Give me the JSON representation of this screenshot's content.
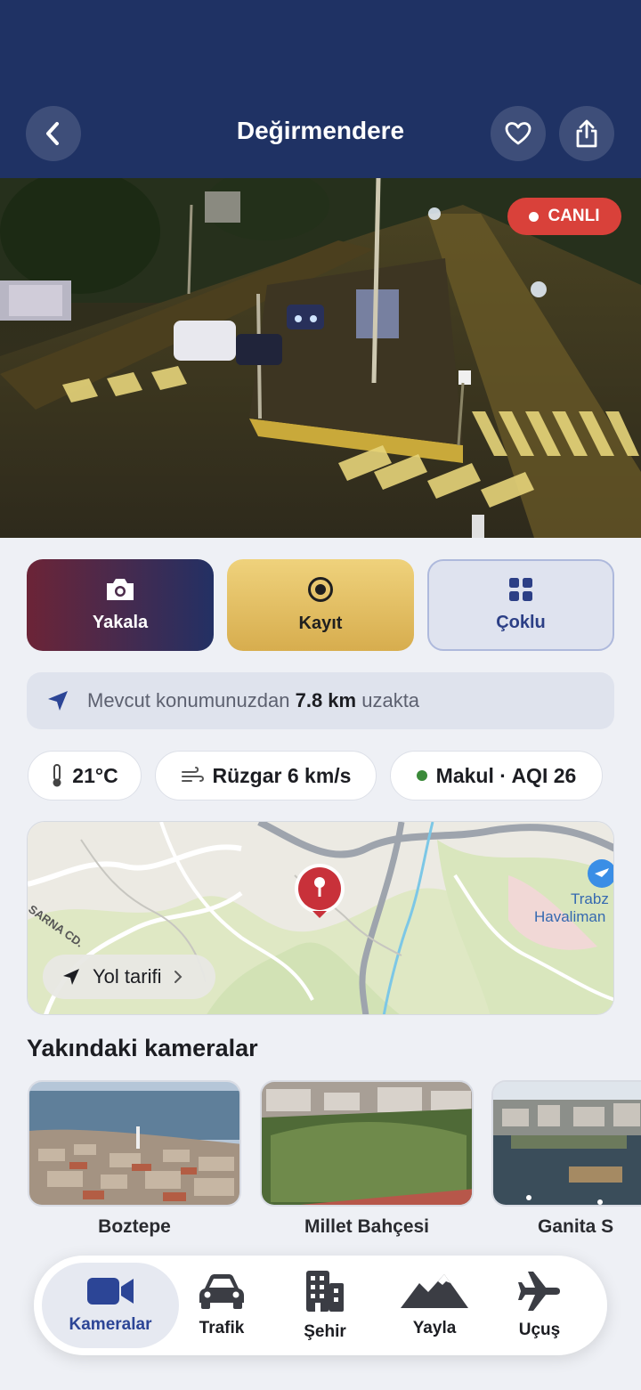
{
  "header": {
    "title": "Değirmendere",
    "back_icon": "chevron-left-icon",
    "favorite_icon": "heart-icon",
    "share_icon": "share-icon"
  },
  "live_badge": {
    "label": "CANLI",
    "color": "#d9413a"
  },
  "actions": [
    {
      "label": "Yakala",
      "icon": "camera-icon"
    },
    {
      "label": "Kayıt",
      "icon": "record-icon"
    },
    {
      "label": "Çoklu",
      "icon": "grid-icon"
    }
  ],
  "distance": {
    "prefix": "Mevcut konumunuzdan",
    "value": "7.8 km",
    "suffix": "uzakta",
    "icon": "location-arrow-icon"
  },
  "weather": {
    "temperature": "21°C",
    "wind": "Rüzgar 6 km/s",
    "air_quality": "Makul · AQI 26",
    "air_quality_color": "#3b8a3a"
  },
  "map": {
    "street_label": "SARNA CD.",
    "airport_label_line1": "Trabz",
    "airport_label_line2": "Havaliman",
    "directions_label": "Yol tarifi"
  },
  "nearby": {
    "title": "Yakındaki kameralar",
    "cameras": [
      {
        "label": "Boztepe"
      },
      {
        "label": "Millet Bahçesi"
      },
      {
        "label": "Ganita S"
      }
    ]
  },
  "tabs": [
    {
      "label": "Kameralar",
      "icon": "video-camera-icon",
      "active": true
    },
    {
      "label": "Trafik",
      "icon": "car-icon",
      "active": false
    },
    {
      "label": "Şehir",
      "icon": "building-icon",
      "active": false
    },
    {
      "label": "Yayla",
      "icon": "mountain-icon",
      "active": false
    },
    {
      "label": "Uçuş",
      "icon": "airplane-icon",
      "active": false
    }
  ],
  "colors": {
    "header_bg": "#1f3264",
    "accent": "#2c4596",
    "gold": "#e2bf63",
    "maroon": "#6c2437"
  }
}
